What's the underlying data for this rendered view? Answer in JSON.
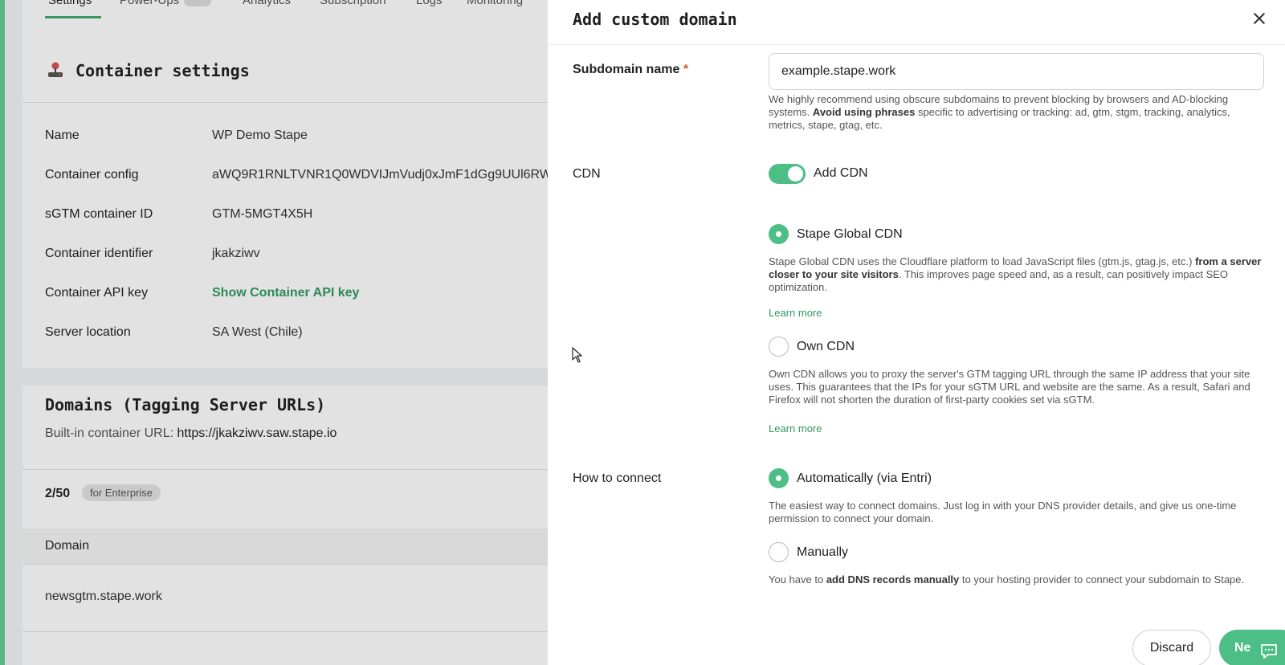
{
  "background": {
    "tabs": [
      "Settings",
      "Power-Ups",
      "Analytics",
      "Subscription",
      "Logs",
      "Monitoring"
    ],
    "container_settings": {
      "title": "Container settings",
      "rows": [
        {
          "label": "Name",
          "value": "WP Demo Stape"
        },
        {
          "label": "Container config",
          "value": "aWQ9R1RNLTVNR1Q0WDVIJmVudj0xJmF1dGg9UUl6RW"
        },
        {
          "label": "sGTM container ID",
          "value": "GTM-5MGT4X5H"
        },
        {
          "label": "Container identifier",
          "value": "jkakziwv"
        },
        {
          "label": "Container API key",
          "value": "Show Container API key"
        },
        {
          "label": "Server location",
          "value": "SA West (Chile)"
        }
      ]
    },
    "domains": {
      "title": "Domains (Tagging Server URLs)",
      "builtin_label": "Built-in container URL:",
      "builtin_url": "https://jkakziwv.saw.stape.io",
      "count": "2/50",
      "badge": "for Enterprise",
      "column": "Domain",
      "rows": [
        "newsgtm.stape.work"
      ]
    }
  },
  "drawer": {
    "title": "Add custom domain",
    "subdomain": {
      "label": "Subdomain name",
      "required": "*",
      "value": "example.stape.work",
      "help_1": "We highly recommend using obscure subdomains to prevent blocking by browsers and AD-blocking systems.",
      "help_bold": "Avoid using phrases",
      "help_2": "specific to advertising or tracking: ad, gtm, stgm, tracking, analytics, metrics, stape, gtag, etc."
    },
    "cdn": {
      "label": "CDN",
      "toggle_label": "Add CDN",
      "toggle_on": true,
      "options": [
        {
          "label": "Stape Global CDN",
          "checked": true,
          "desc_1": "Stape Global CDN uses the Cloudflare platform to load JavaScript files (gtm.js, gtag.js, etc.)",
          "desc_bold": "from a server closer to your site visitors",
          "desc_2": ". This improves page speed and, as a result, can positively impact SEO optimization.",
          "learn_more": "Learn more"
        },
        {
          "label": "Own CDN",
          "checked": false,
          "desc": "Own CDN allows you to proxy the server's GTM tagging URL through the same IP address that your site uses. This guarantees that the IPs for your sGTM URL and website are the same. As a result, Safari and Firefox will not shorten the duration of first-party cookies set via sGTM.",
          "learn_more": "Learn more"
        }
      ]
    },
    "connect": {
      "label": "How to connect",
      "options": [
        {
          "label": "Automatically (via Entri)",
          "checked": true,
          "desc": "The easiest way to connect domains. Just log in with your DNS provider details, and give us one-time permission to connect your domain."
        },
        {
          "label": "Manually",
          "checked": false,
          "desc_1": "You have to",
          "desc_bold": "add DNS records manually",
          "desc_2": "to your hosting provider to connect your subdomain to Stape."
        }
      ]
    },
    "buttons": {
      "discard": "Discard",
      "next": "Ne"
    }
  },
  "colors": {
    "accent": "#4cbe86",
    "link": "#2f9a62",
    "required": "#e05a2a"
  },
  "icons": {
    "close": "close-icon",
    "chat": "chat-icon",
    "joystick": "joystick-icon",
    "cursor": "mouse-cursor-icon"
  }
}
